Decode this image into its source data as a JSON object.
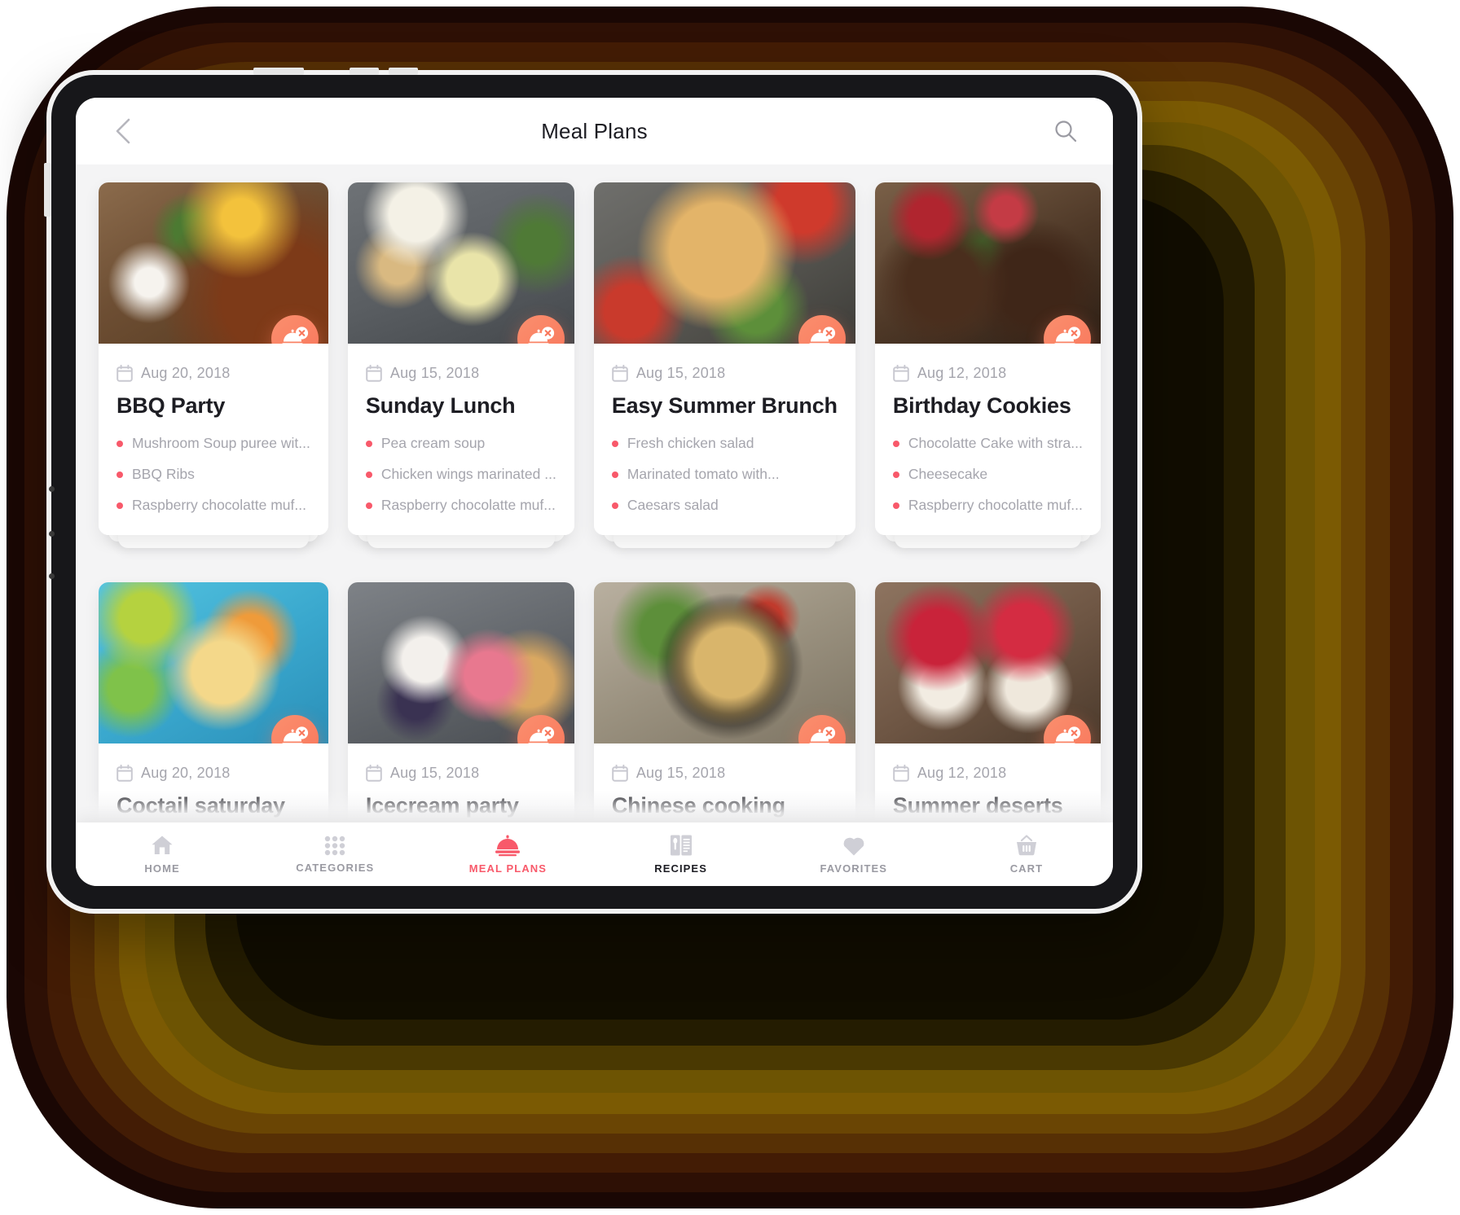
{
  "header": {
    "title": "Meal Plans",
    "back_icon": "chevron-left-icon",
    "search_icon": "search-icon"
  },
  "colors": {
    "accent_orange": "#f8775c",
    "accent_red": "#f8596a",
    "text_dark": "#1d1d23",
    "text_muted": "#a5a5ad",
    "screen_bg": "#f4f4f5",
    "card_bg": "#ffffff"
  },
  "cards": [
    {
      "date": "Aug 20, 2018",
      "title": "BBQ Party",
      "items": [
        "Mushroom Soup puree wit...",
        "BBQ Ribs",
        "Raspberry chocolatte muf..."
      ],
      "fab_icon": "cloche-remove-icon",
      "image": "bbq-ribs-corn-photo"
    },
    {
      "date": "Aug 15, 2018",
      "title": "Sunday Lunch",
      "items": [
        "Pea cream soup",
        "Chicken wings marinated ...",
        "Raspberry chocolatte muf..."
      ],
      "fab_icon": "cloche-remove-icon",
      "image": "cream-soup-bowls-photo"
    },
    {
      "date": "Aug 15, 2018",
      "title": "Easy Summer Brunch",
      "items": [
        "Fresh chicken salad",
        "Marinated tomato with...",
        "Caesars salad"
      ],
      "fab_icon": "cloche-remove-icon",
      "image": "taco-salad-bowl-photo"
    },
    {
      "date": "Aug 12, 2018",
      "title": "Birthday Cookies",
      "items": [
        "Chocolatte Cake with stra...",
        "Cheesecake",
        "Raspberry chocolatte muf..."
      ],
      "fab_icon": "cloche-remove-icon",
      "image": "chocolate-muffins-berries-photo"
    },
    {
      "date": "Aug 20, 2018",
      "title": "Coctail saturday",
      "items": [],
      "fab_icon": "cloche-remove-icon",
      "image": "citrus-cocktail-photo"
    },
    {
      "date": "Aug 15, 2018",
      "title": "Icecream party",
      "items": [],
      "fab_icon": "cloche-remove-icon",
      "image": "icecream-berries-cone-photo"
    },
    {
      "date": "Aug 15, 2018",
      "title": "Chinese cooking",
      "items": [],
      "fab_icon": "cloche-remove-icon",
      "image": "spring-rolls-plate-photo"
    },
    {
      "date": "Aug 12, 2018",
      "title": "Summer deserts",
      "items": [],
      "fab_icon": "cloche-remove-icon",
      "image": "raspberry-trifle-glasses-photo"
    }
  ],
  "tabbar": [
    {
      "label": "HOME",
      "icon": "home-icon",
      "state": "inactive"
    },
    {
      "label": "CATEGORIES",
      "icon": "grid-dots-icon",
      "state": "inactive"
    },
    {
      "label": "MEAL PLANS",
      "icon": "cloche-icon",
      "state": "active-red"
    },
    {
      "label": "RECIPES",
      "icon": "recipe-book-icon",
      "state": "active-dark"
    },
    {
      "label": "FAVORITES",
      "icon": "heart-icon",
      "state": "inactive"
    },
    {
      "label": "CART",
      "icon": "basket-icon",
      "state": "inactive"
    }
  ]
}
